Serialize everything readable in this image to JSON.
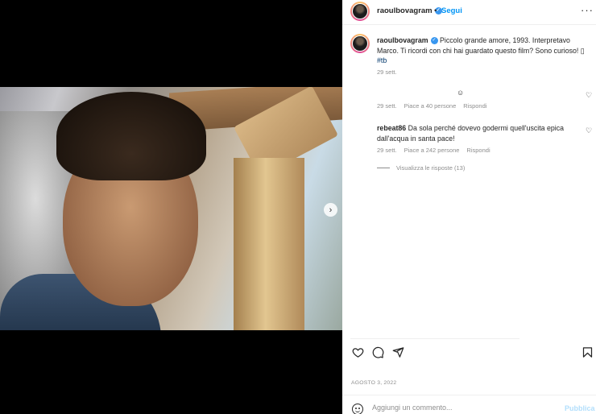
{
  "post_header": {
    "username": "raoulbovagram",
    "separator": "•",
    "follow_label": "Segui",
    "more_icon": "more-horizontal-icon"
  },
  "caption": {
    "username": "raoulbovagram",
    "text": "Piccolo grande amore, 1993. Interpretavo Marco. Ti ricordi con chi hai guardato questo film? Sono curioso! ",
    "unknown_glyph": "▯",
    "hashtag": "#tb",
    "time": "29 sett."
  },
  "comments": [
    {
      "username": "",
      "text": "☺",
      "time": "29 sett.",
      "likes": "Piace a 40 persone",
      "reply_label": "Rispondi"
    },
    {
      "username": "rebeat86",
      "text": "Da sola perché dovevo godermi quell'uscita epica dall'acqua in santa pace!",
      "time": "29 sett.",
      "likes": "Piace a 242 persone",
      "reply_label": "Rispondi",
      "view_replies": "Visualizza le risposte (13)"
    }
  ],
  "post_date": "AGOSTO 3, 2022",
  "comment_input": {
    "placeholder": "Aggiungi un commento...",
    "publish_label": "Pubblica"
  },
  "carousel": {
    "current_slide": 1,
    "total_slides": 2
  },
  "colors": {
    "link_blue": "#0095f6",
    "verified_blue": "#3897f0",
    "muted_text": "#8e8e8e",
    "publish_disabled": "#b2dffc"
  }
}
